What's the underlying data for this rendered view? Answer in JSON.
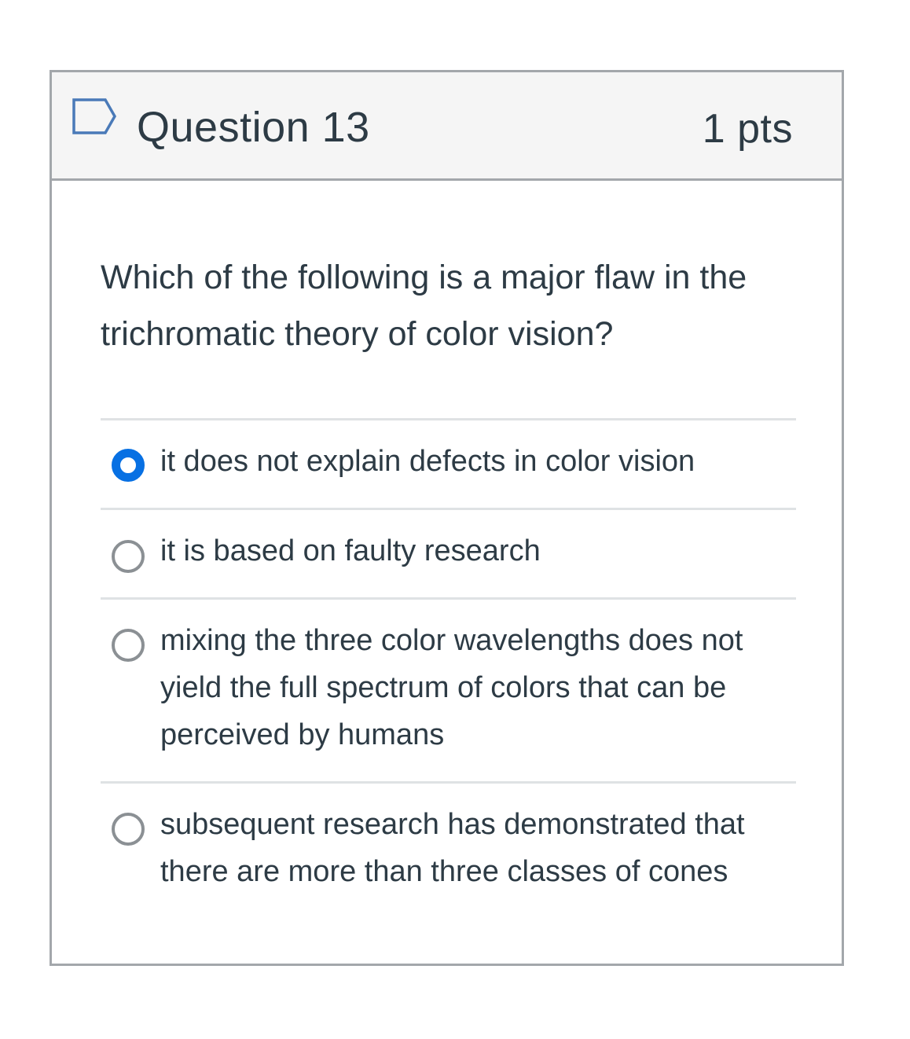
{
  "question": {
    "title": "Question 13",
    "points": "1 pts",
    "flag_icon": "flag-outline-icon",
    "text": "Which of the following is a major flaw in the trichromatic theory of color vision?"
  },
  "answers": [
    {
      "label": "it does not explain defects in color vision",
      "selected": true
    },
    {
      "label": "it is based on faulty research",
      "selected": false
    },
    {
      "label": "mixing the three color wavelengths does not yield the full spectrum of colors that can be perceived by humans",
      "selected": false
    },
    {
      "label": "subsequent research has demonstrated that there are more than three classes of cones",
      "selected": false
    }
  ],
  "colors": {
    "accent": "#0770e3",
    "text": "#2d3b45",
    "border": "#a3a7ab",
    "header_bg": "#f5f5f5",
    "divider": "#dfe2e4"
  }
}
